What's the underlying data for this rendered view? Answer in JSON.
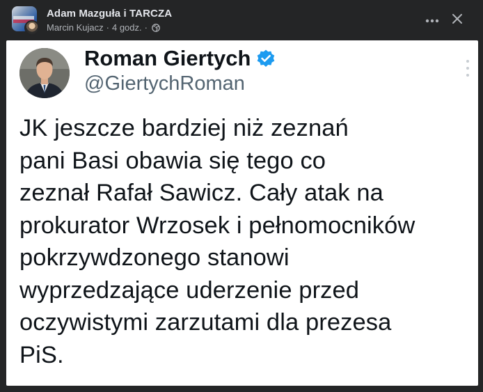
{
  "post_header": {
    "page_name": "Adam Mazguła i TARCZA",
    "author": "Marcin Kujacz",
    "time": "4 godz.",
    "separator": "·"
  },
  "tweet": {
    "display_name": "Roman Giertych",
    "handle": "@GiertychRoman",
    "text": "JK jeszcze bardziej niż zeznań\npani Basi obawia się tego co\nzeznał Rafał Sawicz. Cały atak na\nprokurator Wrzosek i pełnomocników\npokrzywdzonego stanowi\nwyprzedzające uderzenie przed\noczywistymi zarzutami dla prezesa\nPiS."
  },
  "icons": {
    "more": "more-horizontal-icon",
    "close": "close-icon",
    "privacy": "globe-icon",
    "verified": "verified-badge-icon",
    "kebab": "more-vertical-icon"
  },
  "colors": {
    "background": "#242526",
    "primary_text": "#e4e6eb",
    "secondary_text": "#b0b3b8",
    "verified_blue": "#1d9bf0"
  }
}
